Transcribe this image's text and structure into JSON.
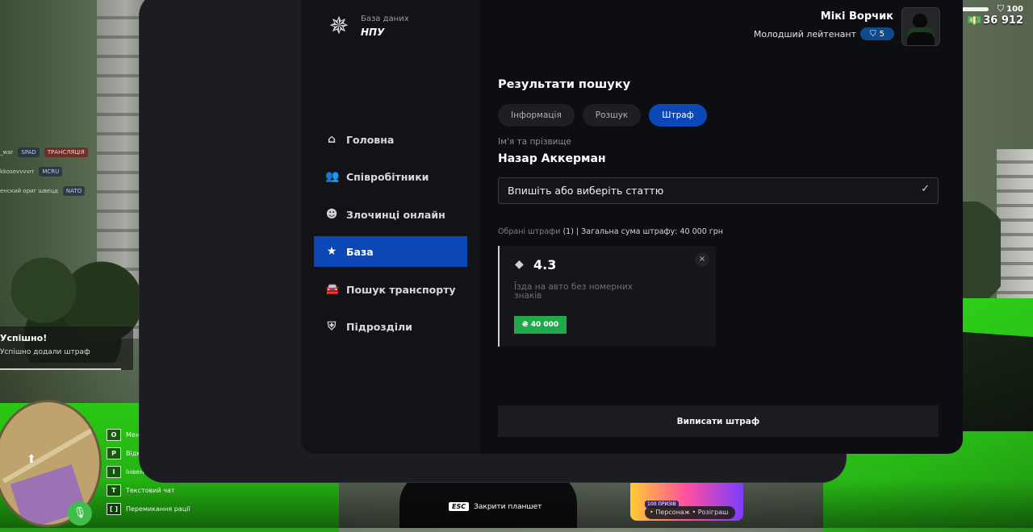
{
  "app": {
    "logo_sub": "База даних",
    "logo_main": "НПУ"
  },
  "user": {
    "name": "Мікі Ворчик",
    "rank": "Молодший лейтенант",
    "level": "5"
  },
  "sidebar": {
    "items": [
      {
        "label": "Головна",
        "icon": "home-icon"
      },
      {
        "label": "Співробітники",
        "icon": "staff-icon"
      },
      {
        "label": "Злочинці онлайн",
        "icon": "criminal-icon"
      },
      {
        "label": "База",
        "icon": "star-icon",
        "active": true
      },
      {
        "label": "Пошук транспорту",
        "icon": "car-icon"
      },
      {
        "label": "Підрозділи",
        "icon": "shield-icon"
      }
    ]
  },
  "main": {
    "title": "Результати пошуку",
    "tabs": [
      {
        "label": "Інформація"
      },
      {
        "label": "Розшук"
      },
      {
        "label": "Штраф",
        "active": true
      }
    ],
    "name_label": "Ім'я та прізвище",
    "name_value": "Назар Аккерман",
    "select_placeholder": "Впишіть або виберіть статтю",
    "summary_muted": "Обрані штрафи",
    "summary_rest": "(1) | Загальна сума штрафу: 40 000 грн",
    "fine": {
      "code": "4.3",
      "description": "Їзда на авто без номерних знаків",
      "amount": "₴ 40 000",
      "close": "×"
    },
    "submit_label": "Виписати штраф"
  },
  "hud": {
    "health": "100",
    "money": "36 912",
    "notify_title": "Успішно!",
    "notify_text": "Успішно додали штраф",
    "chat": [
      {
        "text": "_war",
        "tags": [
          "SPAD",
          "ТРАНСЛЯЦІЯ"
        ]
      },
      {
        "text": "kkosevvvvrr",
        "tags": [
          "MCRU"
        ]
      },
      {
        "text": "енский ориг швецд",
        "tags": [
          "NATO"
        ]
      }
    ],
    "keys": [
      {
        "key": "O",
        "label": "Меню"
      },
      {
        "key": "P",
        "label": "Відкрити"
      },
      {
        "key": "I",
        "label": "Інвентар"
      },
      {
        "key": "T",
        "label": "Текстовий чат"
      },
      {
        "key": "[ ]",
        "label": "Перемикання рації"
      }
    ],
    "esc_key": "ESC",
    "esc_label": "Закрити планшет",
    "promo_badge": "100 ПРИЗІВ",
    "promo_footer": "• Персонаж • Розіграш",
    "mic_label": "Я"
  },
  "colors": {
    "accent": "#0c47b7",
    "fine_amount": "#20a84a",
    "panel": "#0d0e11"
  }
}
